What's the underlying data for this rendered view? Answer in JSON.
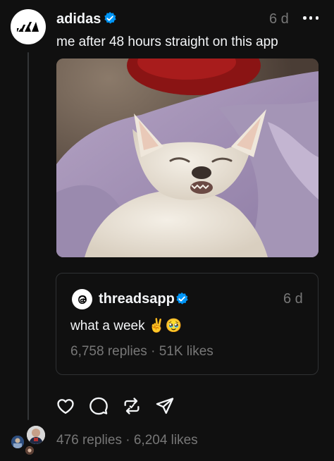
{
  "post": {
    "username": "adidas",
    "timestamp": "6 d",
    "caption": "me after 48 hours straight on this app",
    "image_icon": "photo-chihuahua-sleeping"
  },
  "quoted_post": {
    "username": "threadsapp",
    "timestamp": "6 d",
    "text": "what a week ✌️🥹",
    "replies": "6,758 replies",
    "separator": "·",
    "likes": "51K likes"
  },
  "actions": {
    "icons": [
      "heart-icon",
      "comment-icon",
      "repost-icon",
      "share-icon"
    ]
  },
  "stats": {
    "replies": "476 replies",
    "separator": "·",
    "likes": "6,204 likes"
  },
  "colors": {
    "background": "#101010",
    "text": "#f3f5f7",
    "secondary_text": "#777777",
    "verified": "#0095f6",
    "border": "#2f3133"
  }
}
